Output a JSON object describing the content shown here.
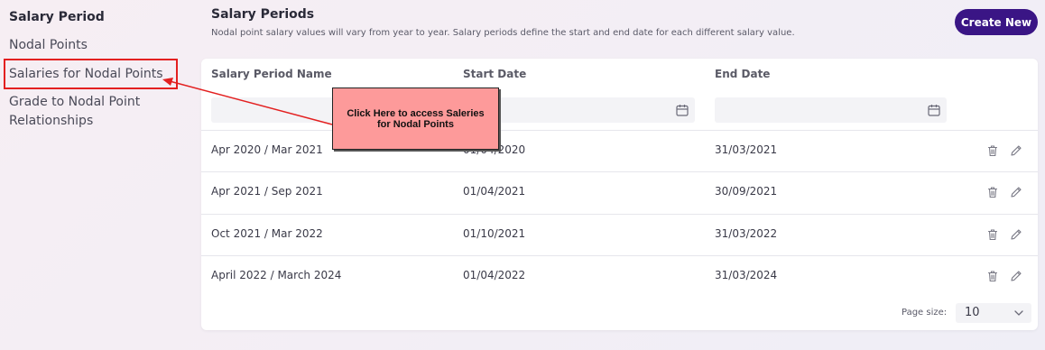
{
  "sidebar": {
    "heading": "Salary Period",
    "items": [
      {
        "label": "Nodal Points"
      },
      {
        "label": "Salaries for Nodal Points"
      },
      {
        "label": "Grade to Nodal Point Relationships"
      }
    ]
  },
  "header": {
    "title": "Salary Periods",
    "description": "Nodal point salary values will vary from year to year. Salary periods define the start and end date for each different salary value.",
    "create_label": "Create New"
  },
  "table": {
    "columns": [
      "Salary Period Name",
      "Start Date",
      "End Date"
    ],
    "rows": [
      {
        "name": "Apr 2020 / Mar 2021",
        "start": "01/04/2020",
        "end": "31/03/2021"
      },
      {
        "name": "Apr 2021 / Sep 2021",
        "start": "01/04/2021",
        "end": "30/09/2021"
      },
      {
        "name": "Oct 2021 / Mar 2022",
        "start": "01/10/2021",
        "end": "31/03/2022"
      },
      {
        "name": "April 2022 / March 2024",
        "start": "01/04/2022",
        "end": "31/03/2024"
      }
    ]
  },
  "pagination": {
    "label": "Page size:",
    "value": "10"
  },
  "annotation": {
    "callout_text": "Click Here to access Saleries for Nodal Points"
  },
  "icons": {
    "delete": "trash-icon",
    "edit": "pencil-icon",
    "calendar": "calendar-icon",
    "chevron": "chevron-down-icon"
  },
  "colors": {
    "accent": "#3a1585",
    "highlight": "#e32020",
    "callout_bg": "#fd9a9a"
  }
}
